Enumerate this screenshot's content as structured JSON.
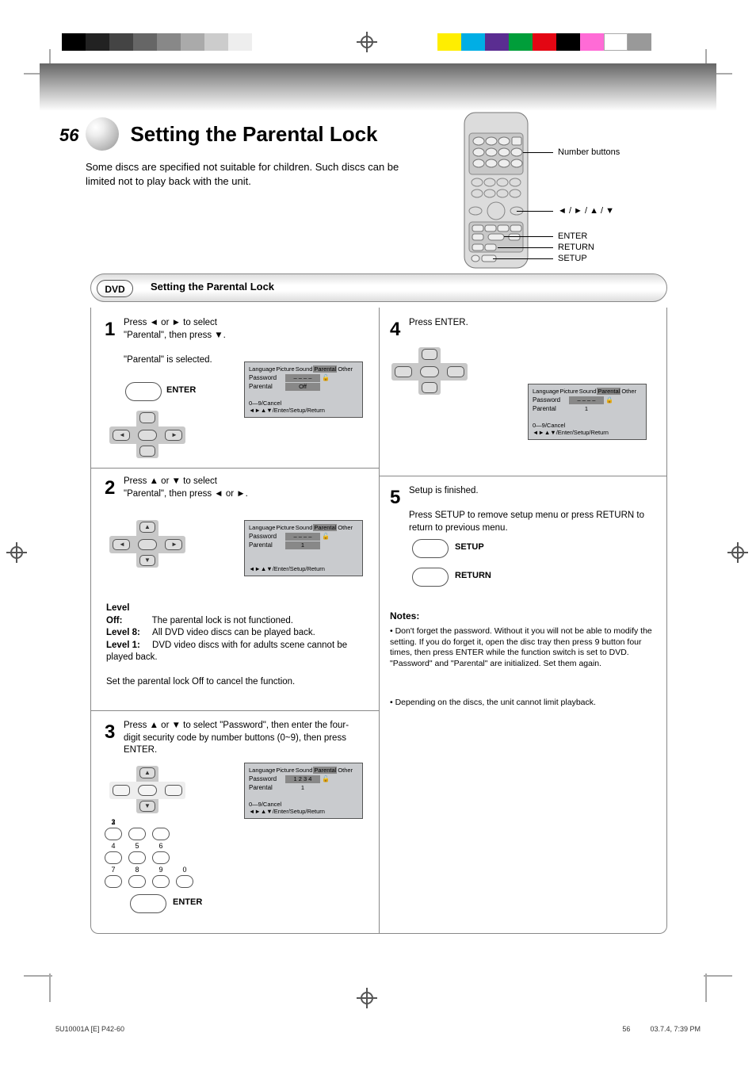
{
  "page_number": "56",
  "title": "Setting the Parental Lock",
  "subtitle": "Some discs are specified not suitable for children. Such discs can be limited not to play back with the unit.",
  "dvd_badge": "DVD",
  "section_header": "Setting the Parental Lock",
  "remote_labels": {
    "number": "Number buttons",
    "arrows": "◄ / ► / ▲ / ▼",
    "enter": "ENTER",
    "return": "RETURN",
    "setup": "SETUP"
  },
  "osd_common": {
    "tabs": [
      "Language",
      "Picture",
      "Sound",
      "Parental",
      "Other"
    ],
    "password_label": "Password",
    "parental_label": "Parental",
    "hint1": "0—9/Cancel",
    "hint2": "◄►▲▼/Enter/Setup/Return",
    "lock_closed": "🔒",
    "lock_open": "🔓",
    "dash": "– – – –"
  },
  "steps": {
    "s1": {
      "text_a": "Press ◄ or ► to select \"Parental\", then press ▼.",
      "text_b": "\"Parental\" is selected.",
      "osd_parental_val": "Off"
    },
    "s2": {
      "text_a": "Press ▲ or ▼ to select \"Parental\", then press ◄ or ►.",
      "level_head": "Level",
      "off_lbl": "Off:",
      "off_txt": "The parental lock is not functioned.",
      "l8_lbl": "Level 8:",
      "l8_txt": "All DVD video discs can be played back.",
      "l1_lbl": "Level 1:",
      "l1_txt": "DVD video discs with for adults scene cannot be played back.",
      "note_line": "Set the parental lock Off to cancel the function.",
      "osd_parental_val": "1"
    },
    "s3": {
      "text_a": "Press ▲ or ▼ to select \"Password\", then enter the four-digit security code by number buttons (0~9), then press ENTER.",
      "osd_pwd_val": "1 2 3 4",
      "osd_parental_val": "1"
    },
    "s4": {
      "text_a": "Press ENTER.",
      "osd_parental_val": "1"
    },
    "s5": {
      "text_a": "Setup is finished.",
      "text_b": "Press SETUP to remove setup menu or press RETURN to return to previous menu."
    }
  },
  "notes": {
    "head": "Notes:",
    "n1": "Don't forget the password. Without it you will not be able to modify the setting. If you do forget it, open the disc tray then press 9 button four times, then press ENTER while the function switch is set to DVD. \"Password\" and \"Parental\" are initialized. Set them again.",
    "n2": "Depending on the discs, the unit cannot limit playback."
  },
  "footer": {
    "left": "5U10001A [E] P42-60",
    "right_page": "56",
    "right_date": "03.7.4, 7:39 PM"
  }
}
